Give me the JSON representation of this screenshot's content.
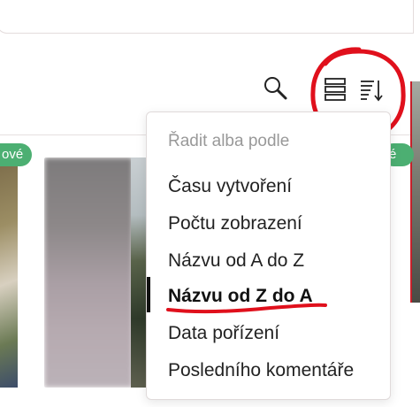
{
  "toolbar": {
    "search_icon": "search-icon",
    "layout_icon": "list-view-icon",
    "sort_icon": "sort-icon"
  },
  "badges": {
    "left": "ové",
    "right": "é"
  },
  "sort_menu": {
    "header": "Řadit alba podle",
    "items": [
      {
        "label": "Času vytvoření",
        "selected": false
      },
      {
        "label": "Počtu zobrazení",
        "selected": false
      },
      {
        "label": "Názvu od A do Z",
        "selected": false
      },
      {
        "label": "Názvu od Z do A",
        "selected": true
      },
      {
        "label": "Data pořízení",
        "selected": false
      },
      {
        "label": "Posledního komentáře",
        "selected": false
      }
    ]
  },
  "colors": {
    "annotation": "#e0101c",
    "badge": "#4caf72",
    "menu_header": "#999999"
  }
}
